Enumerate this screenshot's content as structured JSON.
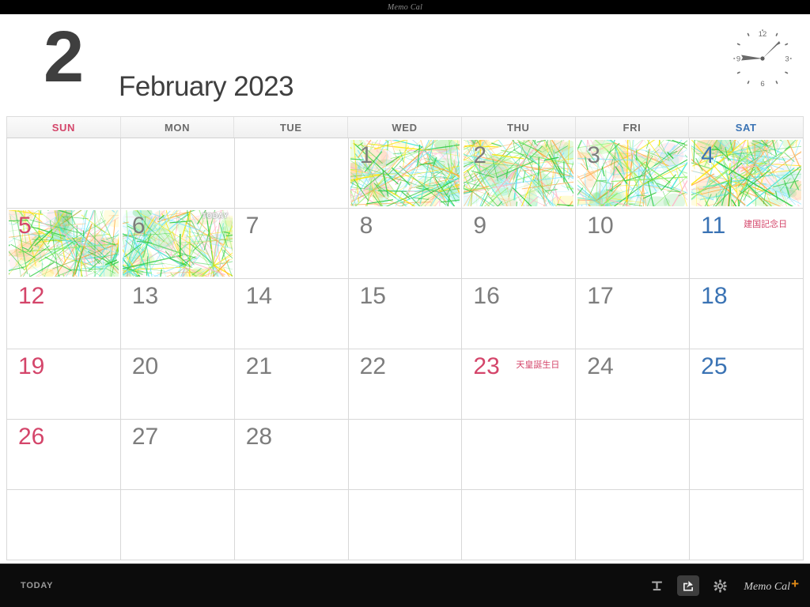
{
  "titlebar": {
    "app_name": "Memo Cal"
  },
  "header": {
    "month_number": "2",
    "month_year": "February 2023",
    "clock": {
      "name": "analog-clock",
      "marks": [
        "12",
        "3",
        "6",
        "9"
      ],
      "hour": 9,
      "minute": 7
    }
  },
  "weekdays": [
    {
      "label": "SUN",
      "kind": "sun"
    },
    {
      "label": "MON",
      "kind": "weekday"
    },
    {
      "label": "TUE",
      "kind": "weekday"
    },
    {
      "label": "WED",
      "kind": "weekday"
    },
    {
      "label": "THU",
      "kind": "weekday"
    },
    {
      "label": "FRI",
      "kind": "weekday"
    },
    {
      "label": "SAT",
      "kind": "sat"
    }
  ],
  "colors": {
    "sunday": "#d4456a",
    "saturday": "#3a73b4",
    "weekday": "#7d7d7d",
    "holiday": "#d4456a",
    "accent_plus": "#e08a16",
    "grid_line": "#d8d8d8"
  },
  "days": [
    {
      "num": "",
      "kind": "empty",
      "doodle": false,
      "holiday": "",
      "today": false
    },
    {
      "num": "",
      "kind": "empty",
      "doodle": false,
      "holiday": "",
      "today": false
    },
    {
      "num": "",
      "kind": "empty",
      "doodle": false,
      "holiday": "",
      "today": false
    },
    {
      "num": "1",
      "kind": "weekday",
      "doodle": true,
      "holiday": "",
      "today": false
    },
    {
      "num": "2",
      "kind": "weekday",
      "doodle": true,
      "holiday": "",
      "today": false
    },
    {
      "num": "3",
      "kind": "weekday",
      "doodle": true,
      "holiday": "",
      "today": false
    },
    {
      "num": "4",
      "kind": "sat",
      "doodle": true,
      "holiday": "",
      "today": false
    },
    {
      "num": "5",
      "kind": "sun",
      "doodle": true,
      "holiday": "",
      "today": false
    },
    {
      "num": "6",
      "kind": "weekday",
      "doodle": true,
      "holiday": "",
      "today": true,
      "today_label": "TODAY"
    },
    {
      "num": "7",
      "kind": "weekday",
      "doodle": false,
      "holiday": "",
      "today": false
    },
    {
      "num": "8",
      "kind": "weekday",
      "doodle": false,
      "holiday": "",
      "today": false
    },
    {
      "num": "9",
      "kind": "weekday",
      "doodle": false,
      "holiday": "",
      "today": false
    },
    {
      "num": "10",
      "kind": "weekday",
      "doodle": false,
      "holiday": "",
      "today": false
    },
    {
      "num": "11",
      "kind": "sat",
      "doodle": false,
      "holiday": "建国記念日",
      "holiday_wide": true,
      "today": false
    },
    {
      "num": "12",
      "kind": "sun",
      "doodle": false,
      "holiday": "",
      "today": false
    },
    {
      "num": "13",
      "kind": "weekday",
      "doodle": false,
      "holiday": "",
      "today": false
    },
    {
      "num": "14",
      "kind": "weekday",
      "doodle": false,
      "holiday": "",
      "today": false
    },
    {
      "num": "15",
      "kind": "weekday",
      "doodle": false,
      "holiday": "",
      "today": false
    },
    {
      "num": "16",
      "kind": "weekday",
      "doodle": false,
      "holiday": "",
      "today": false
    },
    {
      "num": "17",
      "kind": "weekday",
      "doodle": false,
      "holiday": "",
      "today": false
    },
    {
      "num": "18",
      "kind": "sat",
      "doodle": false,
      "holiday": "",
      "today": false
    },
    {
      "num": "19",
      "kind": "sun",
      "doodle": false,
      "holiday": "",
      "today": false
    },
    {
      "num": "20",
      "kind": "weekday",
      "doodle": false,
      "holiday": "",
      "today": false
    },
    {
      "num": "21",
      "kind": "weekday",
      "doodle": false,
      "holiday": "",
      "today": false
    },
    {
      "num": "22",
      "kind": "weekday",
      "doodle": false,
      "holiday": "",
      "today": false
    },
    {
      "num": "23",
      "kind": "sun",
      "doodle": false,
      "holiday": "天皇誕生日",
      "holiday_wide": true,
      "today": false
    },
    {
      "num": "24",
      "kind": "weekday",
      "doodle": false,
      "holiday": "",
      "today": false
    },
    {
      "num": "25",
      "kind": "sat",
      "doodle": false,
      "holiday": "",
      "today": false
    },
    {
      "num": "26",
      "kind": "sun",
      "doodle": false,
      "holiday": "",
      "today": false
    },
    {
      "num": "27",
      "kind": "weekday",
      "doodle": false,
      "holiday": "",
      "today": false
    },
    {
      "num": "28",
      "kind": "weekday",
      "doodle": false,
      "holiday": "",
      "today": false
    },
    {
      "num": "",
      "kind": "empty",
      "doodle": false,
      "holiday": "",
      "today": false
    },
    {
      "num": "",
      "kind": "empty",
      "doodle": false,
      "holiday": "",
      "today": false
    },
    {
      "num": "",
      "kind": "empty",
      "doodle": false,
      "holiday": "",
      "today": false
    },
    {
      "num": "",
      "kind": "empty",
      "doodle": false,
      "holiday": "",
      "today": false
    },
    {
      "num": "",
      "kind": "empty",
      "doodle": false,
      "holiday": "",
      "today": false
    },
    {
      "num": "",
      "kind": "empty",
      "doodle": false,
      "holiday": "",
      "today": false
    },
    {
      "num": "",
      "kind": "empty",
      "doodle": false,
      "holiday": "",
      "today": false
    },
    {
      "num": "",
      "kind": "empty",
      "doodle": false,
      "holiday": "",
      "today": false
    },
    {
      "num": "",
      "kind": "empty",
      "doodle": false,
      "holiday": "",
      "today": false
    },
    {
      "num": "",
      "kind": "empty",
      "doodle": false,
      "holiday": "",
      "today": false
    },
    {
      "num": "",
      "kind": "empty",
      "doodle": false,
      "holiday": "",
      "today": false
    }
  ],
  "toolbar": {
    "today_label": "TODAY",
    "icons": [
      {
        "name": "stamp-icon"
      },
      {
        "name": "share-icon",
        "active": true
      },
      {
        "name": "gear-icon"
      }
    ],
    "brand_text": "Memo Cal",
    "brand_plus": "+"
  },
  "doodle_palette": [
    "#2ecc40",
    "#ffe600",
    "#46e8d8",
    "#ffa63d",
    "#ffb6c8",
    "#8ef06a",
    "#7fe3ff"
  ]
}
